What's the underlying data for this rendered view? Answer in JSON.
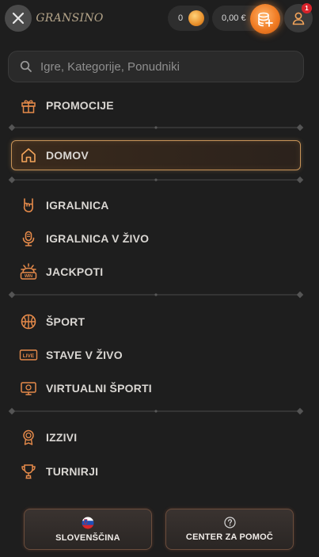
{
  "header": {
    "logo_text": "Gransino",
    "coins_value": "0",
    "balance": "0,00 €",
    "notification_count": "1"
  },
  "search": {
    "placeholder": "Igre, Kategorije, Ponudniki"
  },
  "menu": {
    "promotions": "PROMOCIJE",
    "home": "DOMOV",
    "casino": "IGRALNICA",
    "live_casino": "IGRALNICA V ŽIVO",
    "jackpots": "JACKPOTI",
    "jackpot_icon_text": "WIN",
    "sport": "ŠPORT",
    "live_bets": "STAVE V ŽIVO",
    "live_icon_text": "LIVE",
    "virtual_sports": "VIRTUALNI ŠPORTI",
    "challenges": "IZZIVI",
    "tournaments": "TURNIRJI"
  },
  "footer": {
    "language": "SLOVENŠČINA",
    "help": "CENTER ZA POMOČ"
  },
  "colors": {
    "accent": "#f3a45a",
    "icon": "#e58a4a",
    "background": "#1e1e1e"
  }
}
